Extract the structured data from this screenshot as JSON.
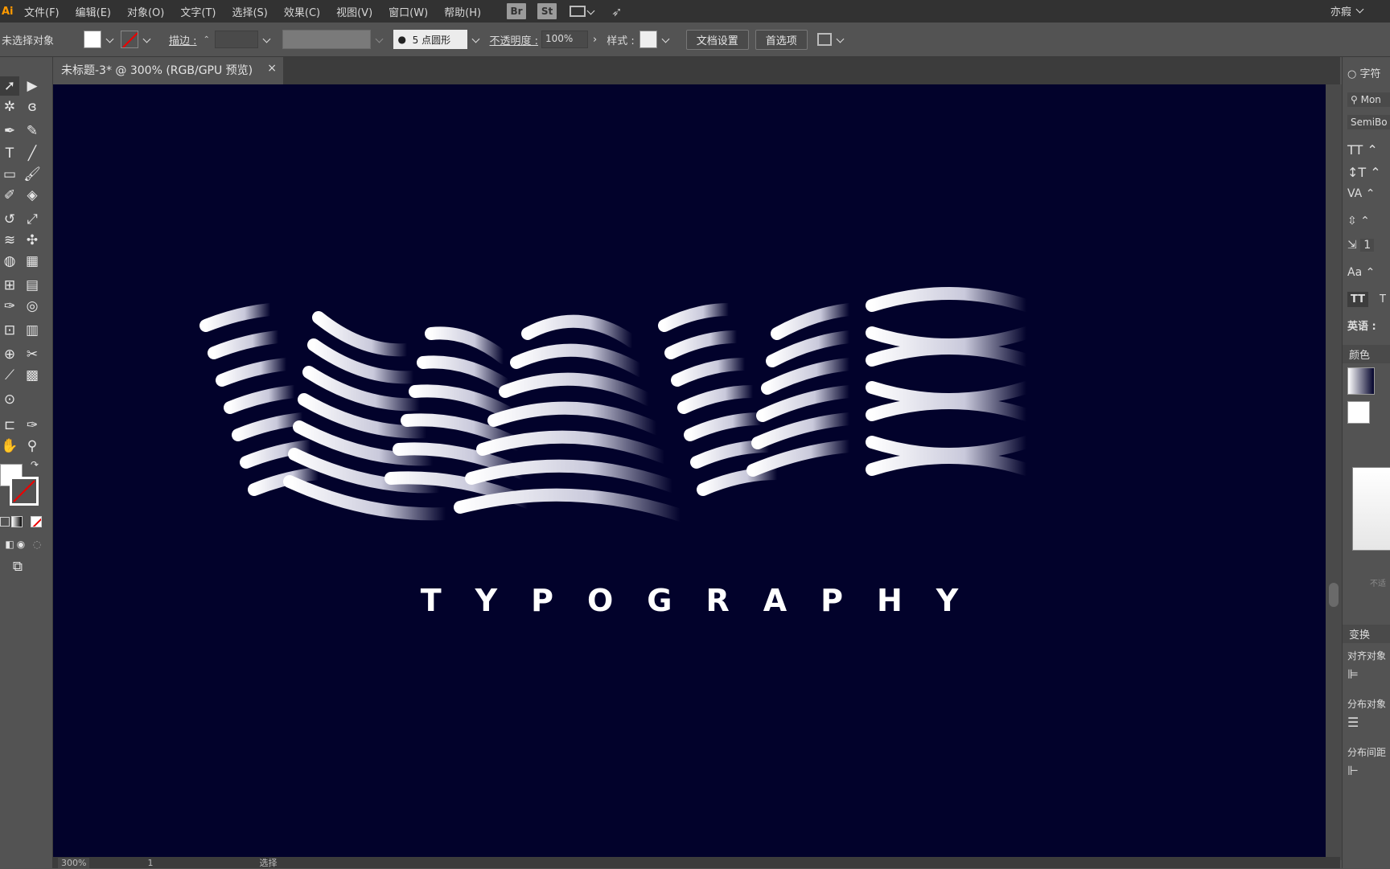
{
  "app": {
    "logo": "Ai"
  },
  "menu": [
    "文件(F)",
    "编辑(E)",
    "对象(O)",
    "文字(T)",
    "选择(S)",
    "效果(C)",
    "视图(V)",
    "窗口(W)",
    "帮助(H)"
  ],
  "menu_icons": [
    {
      "label": "Br",
      "name": "bridge-icon"
    },
    {
      "label": "St",
      "name": "stock-icon"
    }
  ],
  "user": "亦瘕",
  "control": {
    "selection_status": "未选择对象",
    "stroke_label": "描边 :",
    "brush": "5 点圆形",
    "opacity_label": "不透明度 :",
    "opacity_value": "100%",
    "style_label": "样式 :",
    "doc_setup": "文档设置",
    "prefs": "首选项"
  },
  "tab": {
    "title": "未标题-3* @ 300% (RGB/GPU 预览)",
    "close": "×"
  },
  "artwork": {
    "title_word": "WAVE",
    "subtitle": "TYPOGRAPHY",
    "bg_color": "#02022b",
    "stroke_color": "#ffffff"
  },
  "right_panel": {
    "character_title": "字符",
    "font_search": "Mon",
    "font_style": "SemiBo",
    "lang_label": "英语 :",
    "color_title": "颜色",
    "transform_title": "变换",
    "align_objects": "对齐对象",
    "distribute_objects": "分布对象",
    "distribute_spacing": "分布间距",
    "tt": "TT",
    "tr": "T",
    "not_label": "不适",
    "track_value": "1"
  },
  "status": {
    "zoom": "300%",
    "page": "1",
    "mode": "选择"
  }
}
